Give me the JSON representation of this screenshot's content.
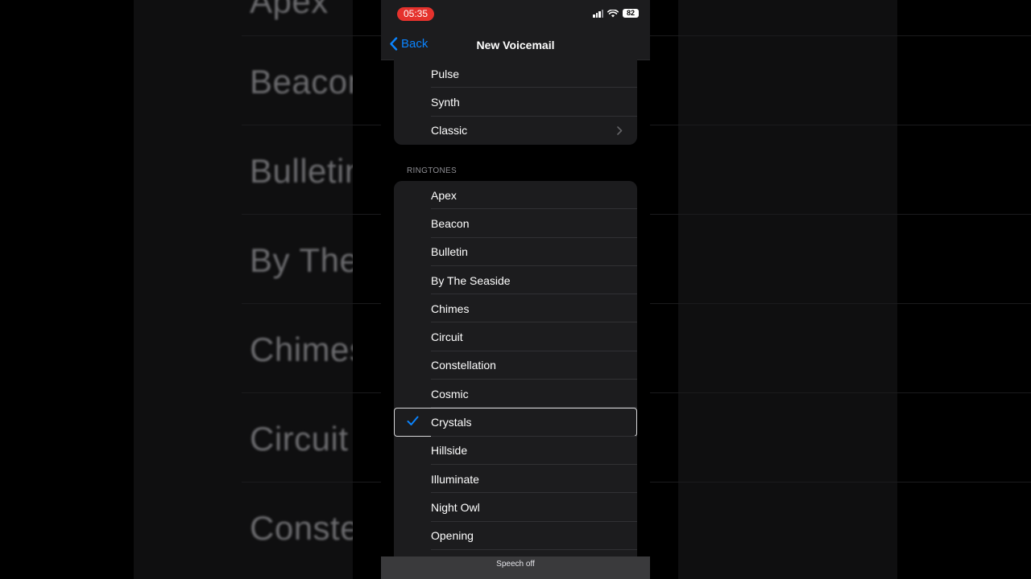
{
  "background": {
    "words": [
      "Apex",
      "Beacon",
      "Bulletin",
      "By The Seaside",
      "Chimes",
      "Circuit",
      "Constellation"
    ]
  },
  "status_bar": {
    "time": "05:35",
    "battery": "82",
    "signal_icon": "cellular-signal-icon",
    "wifi_icon": "wifi-icon"
  },
  "nav": {
    "back_label": "Back",
    "title": "New Voicemail",
    "back_icon": "chevron-left-icon"
  },
  "alert_tones": {
    "items": [
      "Pulse",
      "Synth",
      "Classic"
    ]
  },
  "ringtones": {
    "header": "RINGTONES",
    "items": [
      "Apex",
      "Beacon",
      "Bulletin",
      "By The Seaside",
      "Chimes",
      "Circuit",
      "Constellation",
      "Cosmic",
      "Crystals",
      "Hillside",
      "Illuminate",
      "Night Owl",
      "Opening"
    ],
    "selected": "Crystals",
    "check_icon": "checkmark-icon"
  },
  "speech_bar": {
    "text": "Speech off"
  },
  "colors": {
    "accent": "#0a84ff",
    "time_pill": "#e5322d",
    "group_bg": "#1c1c1e",
    "header_text": "#8e8e93"
  }
}
